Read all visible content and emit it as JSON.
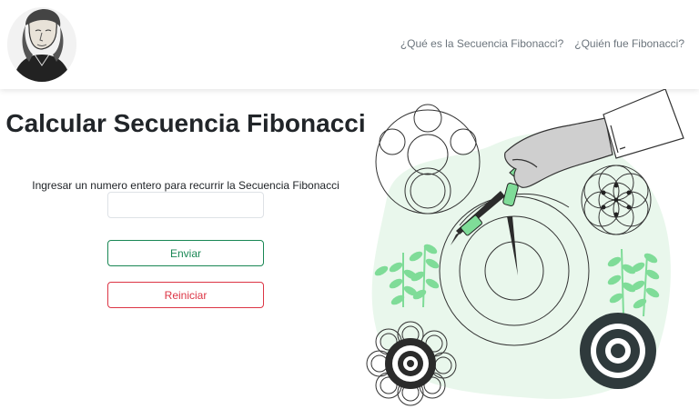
{
  "navbar": {
    "logo_icon": "fibonacci-portrait",
    "links": [
      {
        "label": "¿Qué es la Secuencia Fibonacci?"
      },
      {
        "label": "¿Quién fue Fibonacci?"
      }
    ]
  },
  "main": {
    "title": "Calcular Secuencia Fibonacci",
    "instruction": "Ingresar un numero entero para recurrir la Secuencia Fibonacci",
    "input": {
      "value": "",
      "placeholder": ""
    },
    "submit_label": "Enviar",
    "reset_label": "Reiniciar"
  },
  "illustration": {
    "icon": "compass-circles-illustration"
  },
  "colors": {
    "accent_green": "#198754",
    "danger_red": "#dc3545",
    "nav_text": "#6c757d",
    "illustration_green": "#7fdc98",
    "illustration_bg": "#e9f7ec"
  }
}
